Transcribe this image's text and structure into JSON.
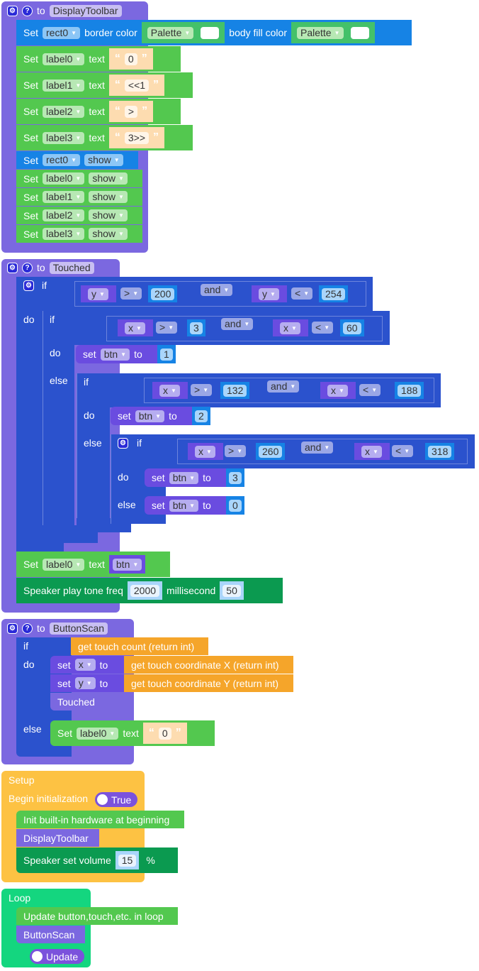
{
  "procedures": {
    "display_toolbar": {
      "keyword": "to",
      "name": "DisplayToolbar",
      "statements": [
        {
          "set": "Set",
          "target": "rect0",
          "prop1": "border color",
          "palette1": "Palette",
          "prop2": "body fill color",
          "palette2": "Palette"
        },
        {
          "set": "Set",
          "target": "label0",
          "prop": "text",
          "value": "0"
        },
        {
          "set": "Set",
          "target": "label1",
          "prop": "text",
          "value": "<<1"
        },
        {
          "set": "Set",
          "target": "label2",
          "prop": "text",
          "value": ">"
        },
        {
          "set": "Set",
          "target": "label3",
          "prop": "text",
          "value": "3>>"
        },
        {
          "set": "Set",
          "target": "rect0",
          "mode": "show"
        },
        {
          "set": "Set",
          "target": "label0",
          "mode": "show"
        },
        {
          "set": "Set",
          "target": "label1",
          "mode": "show"
        },
        {
          "set": "Set",
          "target": "label2",
          "mode": "show"
        },
        {
          "set": "Set",
          "target": "label3",
          "mode": "show"
        }
      ]
    },
    "touched": {
      "keyword": "to",
      "name": "Touched",
      "kw_if": "if",
      "kw_do": "do",
      "kw_else": "else",
      "kw_and": "and",
      "kw_set": "set",
      "kw_to": "to",
      "outer_cond": {
        "a_var": "y",
        "a_op": ">",
        "a_val": "200",
        "b_var": "y",
        "b_op": "<",
        "b_val": "254"
      },
      "cond1": {
        "a_var": "x",
        "a_op": ">",
        "a_val": "3",
        "b_var": "x",
        "b_op": "<",
        "b_val": "60"
      },
      "cond2": {
        "a_var": "x",
        "a_op": ">",
        "a_val": "132",
        "b_var": "x",
        "b_op": "<",
        "b_val": "188"
      },
      "cond3": {
        "a_var": "x",
        "a_op": ">",
        "a_val": "260",
        "b_var": "x",
        "b_op": "<",
        "b_val": "318"
      },
      "set_var": "btn",
      "values": [
        "1",
        "2",
        "3",
        "0"
      ],
      "label_set": {
        "set": "Set",
        "target": "label0",
        "prop": "text",
        "var": "btn"
      },
      "tone": {
        "label": "Speaker play tone freq",
        "freq": "2000",
        "ms_label": "millisecond",
        "ms": "50"
      }
    },
    "button_scan": {
      "keyword": "to",
      "name": "ButtonScan",
      "kw_if": "if",
      "kw_do": "do",
      "kw_else": "else",
      "cond": "get touch count (return int)",
      "set_x": {
        "kw": "set",
        "var": "x",
        "to": "to",
        "fn": "get touch coordinate X (return int)"
      },
      "set_y": {
        "kw": "set",
        "var": "y",
        "to": "to",
        "fn": "get touch coordinate Y (return int)"
      },
      "call": "Touched",
      "else_set": {
        "set": "Set",
        "target": "label0",
        "prop": "text",
        "value": "0"
      }
    }
  },
  "setup": {
    "title": "Setup",
    "begin": "Begin initialization",
    "toggle": "True",
    "init": "Init built-in hardware at beginning",
    "call": "DisplayToolbar",
    "volume_label": "Speaker set volume",
    "volume": "15",
    "volume_unit": "%"
  },
  "loop": {
    "title": "Loop",
    "update": "Update button,touch,etc. in loop",
    "call": "ButtonScan",
    "toggle": "Update"
  },
  "icons": {
    "gear": "⚙",
    "help": "?",
    "dropdown": "▼",
    "quote_open": "“",
    "quote_close": "”"
  }
}
